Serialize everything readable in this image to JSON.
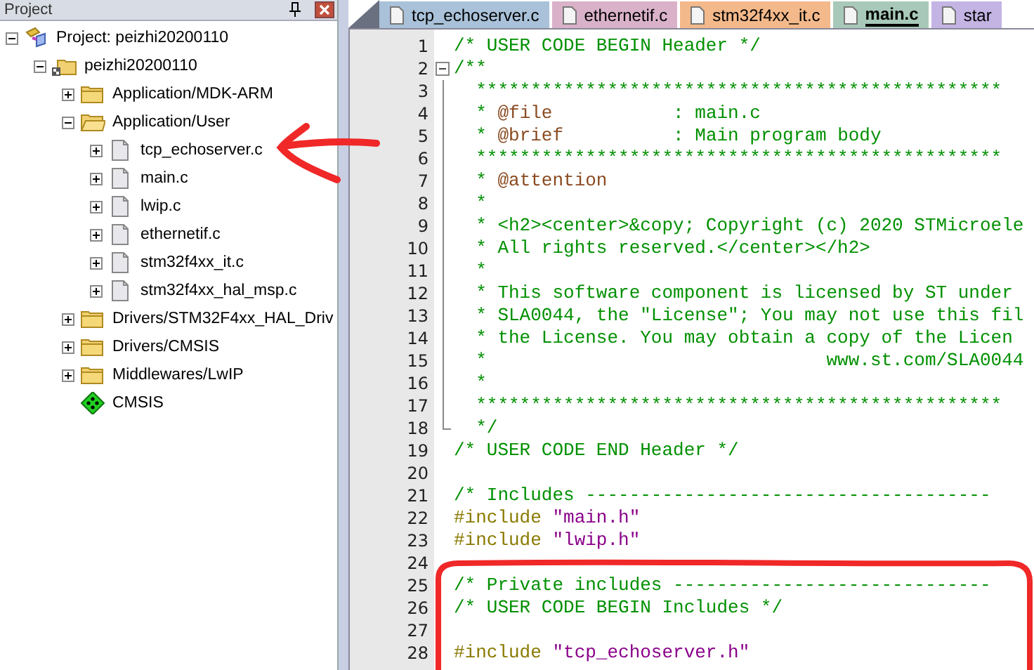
{
  "project_panel": {
    "title": "Project",
    "tree": [
      {
        "kind": "project",
        "label": "Project: peizhi20200110",
        "expanded": true,
        "children": [
          {
            "kind": "target",
            "label": "peizhi20200110",
            "expanded": true,
            "children": [
              {
                "kind": "folder",
                "label": "Application/MDK-ARM",
                "expanded": false
              },
              {
                "kind": "folder",
                "label": "Application/User",
                "expanded": true,
                "children": [
                  {
                    "kind": "file",
                    "label": "tcp_echoserver.c",
                    "expanded": false
                  },
                  {
                    "kind": "file",
                    "label": "main.c",
                    "expanded": false
                  },
                  {
                    "kind": "file",
                    "label": "lwip.c",
                    "expanded": false
                  },
                  {
                    "kind": "file",
                    "label": "ethernetif.c",
                    "expanded": false
                  },
                  {
                    "kind": "file",
                    "label": "stm32f4xx_it.c",
                    "expanded": false
                  },
                  {
                    "kind": "file",
                    "label": "stm32f4xx_hal_msp.c",
                    "expanded": false
                  }
                ]
              },
              {
                "kind": "folder",
                "label": "Drivers/STM32F4xx_HAL_Driv",
                "expanded": false
              },
              {
                "kind": "folder",
                "label": "Drivers/CMSIS",
                "expanded": false
              },
              {
                "kind": "folder",
                "label": "Middlewares/LwIP",
                "expanded": false
              },
              {
                "kind": "component",
                "label": "CMSIS"
              }
            ]
          }
        ]
      }
    ]
  },
  "tabs": [
    {
      "label": "tcp_echoserver.c",
      "color": "#a9c2d9",
      "selected": false
    },
    {
      "label": "ethernetif.c",
      "color": "#d9b2c9",
      "selected": false
    },
    {
      "label": "stm32f4xx_it.c",
      "color": "#f4b98a",
      "selected": false
    },
    {
      "label": "main.c",
      "color": "#a8c9b9",
      "selected": true
    },
    {
      "label": "star",
      "color": "#c3b4e4",
      "selected": false
    }
  ],
  "editor": {
    "lines": [
      {
        "number": "1",
        "segments": [
          {
            "kind": "comment",
            "text": "/* USER CODE BEGIN Header */"
          }
        ]
      },
      {
        "number": "2",
        "expanded": true,
        "segments": [
          {
            "kind": "comment",
            "text": "/**"
          }
        ],
        "children": [
          {
            "number": "3",
            "segments": [
              {
                "kind": "comment",
                "text": "  ************************************************"
              }
            ]
          },
          {
            "number": "4",
            "segments": [
              {
                "kind": "comment",
                "text": "  * "
              },
              {
                "kind": "doctag",
                "text": "@file"
              },
              {
                "kind": "comment",
                "text": "           : main.c"
              }
            ]
          },
          {
            "number": "5",
            "segments": [
              {
                "kind": "comment",
                "text": "  * "
              },
              {
                "kind": "doctag",
                "text": "@brief"
              },
              {
                "kind": "comment",
                "text": "          : Main program body"
              }
            ]
          },
          {
            "number": "6",
            "segments": [
              {
                "kind": "comment",
                "text": "  ************************************************"
              }
            ]
          },
          {
            "number": "7",
            "segments": [
              {
                "kind": "comment",
                "text": "  * "
              },
              {
                "kind": "doctag",
                "text": "@attention"
              }
            ]
          },
          {
            "number": "8",
            "segments": [
              {
                "kind": "comment",
                "text": "  *"
              }
            ]
          },
          {
            "number": "9",
            "segments": [
              {
                "kind": "comment",
                "text": "  * <h2><center>&copy; Copyright (c) 2020 STMicroele"
              }
            ]
          },
          {
            "number": "10",
            "segments": [
              {
                "kind": "comment",
                "text": "  * All rights reserved.</center></h2>"
              }
            ]
          },
          {
            "number": "11",
            "segments": [
              {
                "kind": "comment",
                "text": "  *"
              }
            ]
          },
          {
            "number": "12",
            "segments": [
              {
                "kind": "comment",
                "text": "  * This software component is licensed by ST under"
              }
            ]
          },
          {
            "number": "13",
            "segments": [
              {
                "kind": "comment",
                "text": "  * SLA0044, the \"License\"; You may not use this fil"
              }
            ]
          },
          {
            "number": "14",
            "segments": [
              {
                "kind": "comment",
                "text": "  * the License. You may obtain a copy of the Licen"
              }
            ]
          },
          {
            "number": "15",
            "segments": [
              {
                "kind": "comment",
                "text": "  *                               www.st.com/SLA0044"
              }
            ]
          },
          {
            "number": "16",
            "segments": [
              {
                "kind": "comment",
                "text": "  *"
              }
            ]
          },
          {
            "number": "17",
            "segments": [
              {
                "kind": "comment",
                "text": "  ************************************************"
              }
            ]
          },
          {
            "number": "18",
            "segments": [
              {
                "kind": "comment",
                "text": "  */"
              }
            ]
          }
        ]
      },
      {
        "number": "19",
        "segments": [
          {
            "kind": "comment",
            "text": "/* USER CODE END Header */"
          }
        ]
      },
      {
        "number": "20"
      },
      {
        "number": "21",
        "segments": [
          {
            "kind": "comment",
            "text": "/* Includes -------------------------------------"
          }
        ]
      },
      {
        "number": "22",
        "segments": [
          {
            "kind": "directive",
            "text": "#include "
          },
          {
            "kind": "string",
            "text": "\"main.h\""
          }
        ]
      },
      {
        "number": "23",
        "segments": [
          {
            "kind": "directive",
            "text": "#include "
          },
          {
            "kind": "string",
            "text": "\"lwip.h\""
          }
        ]
      },
      {
        "number": "24"
      },
      {
        "number": "25",
        "segments": [
          {
            "kind": "comment",
            "text": "/* Private includes -----------------------------"
          }
        ]
      },
      {
        "number": "26",
        "segments": [
          {
            "kind": "comment",
            "text": "/* USER CODE BEGIN Includes */"
          }
        ]
      },
      {
        "number": "27"
      },
      {
        "number": "28",
        "segments": [
          {
            "kind": "directive",
            "text": "#include "
          },
          {
            "kind": "string",
            "text": "\"tcp_echoserver.h\""
          }
        ]
      }
    ]
  }
}
